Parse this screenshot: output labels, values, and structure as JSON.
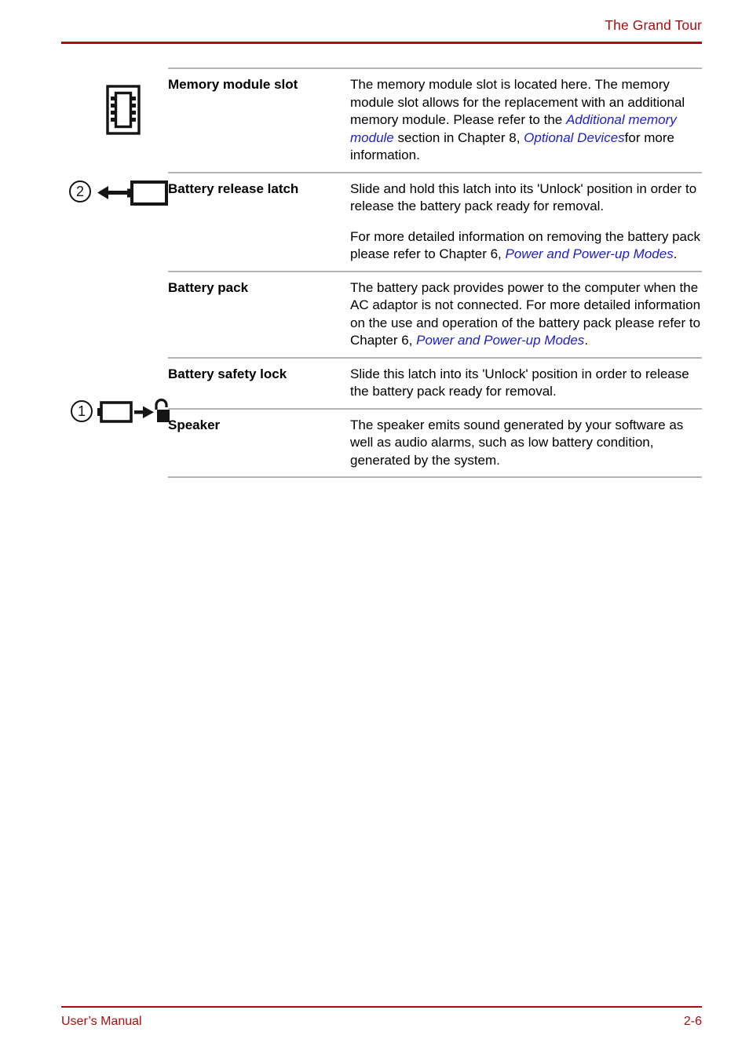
{
  "header": {
    "title": "The Grand Tour"
  },
  "footer": {
    "left": "User’s Manual",
    "page": "2-6"
  },
  "table": {
    "rows": [
      {
        "icon": "memory-module-icon",
        "marker": "",
        "label": "Memory module slot",
        "paragraphs": [
          {
            "runs": [
              {
                "text": "The memory module slot is located here. The memory module slot allows for the replacement with an additional memory module. Please refer to the ",
                "style": "normal"
              },
              {
                "text": "Additional memory module",
                "style": "link"
              },
              {
                "text": " section in Chapter 8, ",
                "style": "normal"
              },
              {
                "text": "Optional Devices",
                "style": "link"
              },
              {
                "text": "for more information.",
                "style": "normal"
              }
            ]
          }
        ]
      },
      {
        "icon": "battery-release-latch-icon",
        "marker": "2",
        "label": "Battery release latch",
        "paragraphs": [
          {
            "runs": [
              {
                "text": "Slide and hold this latch into its 'Unlock' position in order to release the battery pack ready for removal.",
                "style": "normal"
              }
            ]
          },
          {
            "runs": [
              {
                "text": "For more detailed information on removing the battery pack please refer to Chapter 6, ",
                "style": "normal"
              },
              {
                "text": "Power and Power-up Modes",
                "style": "link"
              },
              {
                "text": ".",
                "style": "normal"
              }
            ]
          }
        ]
      },
      {
        "icon": "",
        "marker": "",
        "label": "Battery pack",
        "paragraphs": [
          {
            "runs": [
              {
                "text": "The battery pack provides power to the computer when the AC adaptor is not connected. For more detailed information on the use and operation of the battery pack please refer to Chapter 6, ",
                "style": "normal"
              },
              {
                "text": "Power and Power-up Modes",
                "style": "link"
              },
              {
                "text": ".",
                "style": "normal"
              }
            ]
          }
        ]
      },
      {
        "icon": "battery-safety-lock-icon",
        "marker": "1",
        "label": "Battery safety lock",
        "paragraphs": [
          {
            "runs": [
              {
                "text": "Slide this latch into its 'Unlock' position in order to release the battery pack ready for removal.",
                "style": "normal"
              }
            ]
          }
        ]
      },
      {
        "icon": "",
        "marker": "",
        "label": "Speaker",
        "paragraphs": [
          {
            "runs": [
              {
                "text": "The speaker emits sound generated by your software as well as audio alarms, such as low battery condition, generated by the system.",
                "style": "normal"
              }
            ]
          }
        ]
      }
    ]
  },
  "colors": {
    "accent_red": "#a50f0f",
    "link_blue": "#2020c4",
    "rule_gray": "#b5b5b5",
    "icon_black": "#151515"
  }
}
